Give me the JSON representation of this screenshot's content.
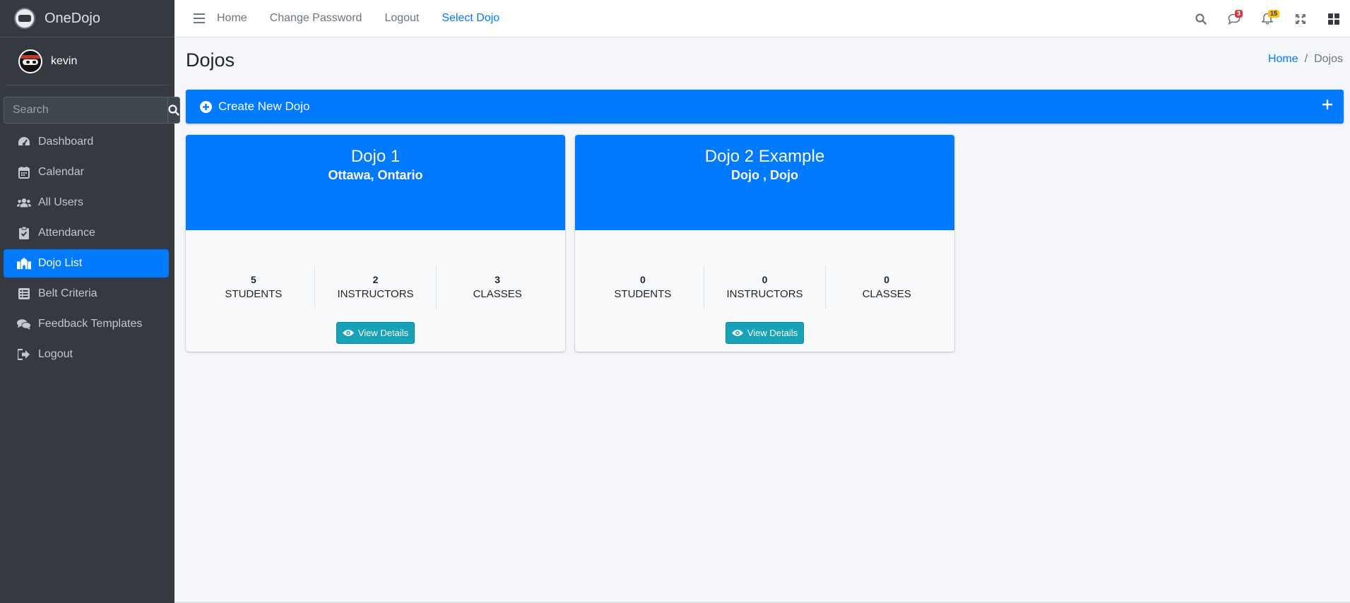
{
  "app": {
    "brand": "OneDojo"
  },
  "user": {
    "name": "kevin"
  },
  "sidebar": {
    "search_placeholder": "Search",
    "items": [
      {
        "label": "Dashboard",
        "icon": "dashboard-icon"
      },
      {
        "label": "Calendar",
        "icon": "calendar-icon"
      },
      {
        "label": "All Users",
        "icon": "users-icon"
      },
      {
        "label": "Attendance",
        "icon": "clipboard-check-icon"
      },
      {
        "label": "Dojo List",
        "icon": "dojo-building-icon",
        "active": true
      },
      {
        "label": "Belt Criteria",
        "icon": "list-icon"
      },
      {
        "label": "Feedback Templates",
        "icon": "comments-icon"
      },
      {
        "label": "Logout",
        "icon": "sign-out-icon"
      }
    ]
  },
  "navbar": {
    "links": [
      "Home",
      "Change Password",
      "Logout",
      "Select Dojo"
    ],
    "messages_badge": "3",
    "notifications_badge": "15"
  },
  "page": {
    "title": "Dojos",
    "breadcrumb": {
      "home": "Home",
      "current": "Dojos"
    },
    "create_label": "Create New Dojo"
  },
  "dojos": [
    {
      "name": "Dojo 1",
      "location": "Ottawa, Ontario",
      "stats": [
        {
          "value": "5",
          "label": "STUDENTS"
        },
        {
          "value": "2",
          "label": "INSTRUCTORS"
        },
        {
          "value": "3",
          "label": "CLASSES"
        }
      ],
      "button": "View Details"
    },
    {
      "name": "Dojo 2 Example",
      "location": "Dojo , Dojo",
      "stats": [
        {
          "value": "0",
          "label": "STUDENTS"
        },
        {
          "value": "0",
          "label": "INSTRUCTORS"
        },
        {
          "value": "0",
          "label": "CLASSES"
        }
      ],
      "button": "View Details"
    }
  ],
  "colors": {
    "primary": "#007bff",
    "sidebar": "#343a40",
    "info": "#17a2b8",
    "badge_red": "#dc3545",
    "badge_yellow": "#ffc107"
  }
}
